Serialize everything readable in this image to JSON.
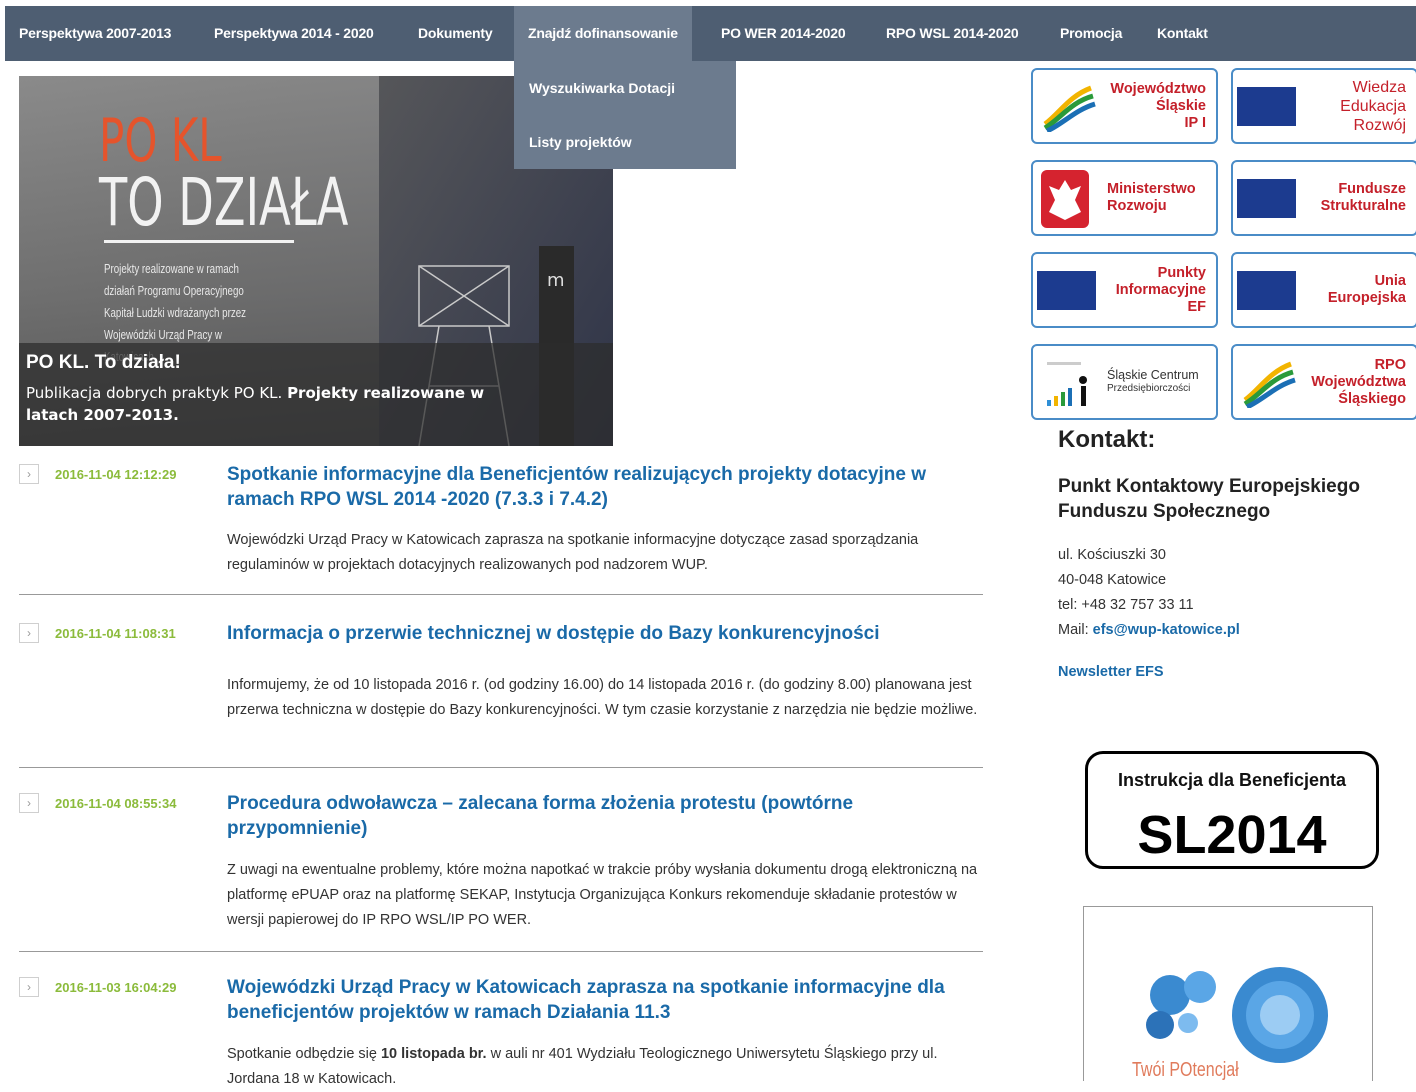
{
  "nav": {
    "items": [
      {
        "label": "Perspektywa 2007-2013"
      },
      {
        "label": "Perspektywa 2014 - 2020"
      },
      {
        "label": "Dokumenty"
      },
      {
        "label": "Znajdź dofinansowanie",
        "active": true
      },
      {
        "label": "PO WER 2014-2020"
      },
      {
        "label": "RPO WSL 2014-2020"
      },
      {
        "label": "Promocja"
      },
      {
        "label": "Kontakt"
      }
    ],
    "dropdown": [
      "Wyszukiwarka Dotacji",
      "Listy projektów"
    ],
    "background": "#4e5e72",
    "active_background": "#6c7b8e"
  },
  "hero": {
    "image_title_line1": "PO KL",
    "image_title_line2": "TO DZIAŁA",
    "image_small_text": "Projekty realizowane w ramach działań Programu Operacyjnego Kapitał Ludzki wdrażanych przez Wojewódzki Urząd Pracy w Katowicach",
    "caption_title": "PO KL. To działa!",
    "caption_text_plain": "Publikacja dobrych praktyk PO KL. ",
    "caption_text_bold": "Projekty realizowane w latach 2007-2013."
  },
  "news": [
    {
      "date": "2016-11-04 12:12:29",
      "title": "Spotkanie informacyjne dla Beneficjentów realizujących projekty dotacyjne w ramach RPO WSL 2014 -2020 (7.3.3 i 7.4.2)",
      "body": "Wojewódzki Urząd Pracy w Katowicach zaprasza na spotkanie informacyjne dotyczące zasad sporządzania regulaminów w projektach dotacyjnych realizowanych pod nadzorem WUP."
    },
    {
      "date": "2016-11-04 11:08:31",
      "title": "Informacja o przerwie technicznej w dostępie do Bazy konkurencyjności",
      "body": "Informujemy, że od 10 listopada 2016 r. (od godziny 16.00) do 14 listopada 2016 r. (do godziny 8.00) planowana jest przerwa techniczna w dostępie do Bazy konkurencyjności. W tym czasie korzystanie z narzędzia nie będzie możliwe."
    },
    {
      "date": "2016-11-04 08:55:34",
      "title": "Procedura odwoławcza – zalecana forma złożenia protestu (powtórne przypomnienie)",
      "body": "Z uwagi na ewentualne problemy, które można napotkać w trakcie próby wysłania dokumentu drogą elektroniczną na platformę ePUAP oraz na platformę SEKAP, Instytucja Organizująca Konkurs rekomenduje składanie protestów w wersji papierowej do IP RPO WSL/IP PO WER."
    },
    {
      "date": "2016-11-03 16:04:29",
      "title": "Wojewódzki Urząd Pracy w Katowicach zaprasza na spotkanie informacyjne dla beneficjentów projektów w ramach Działania 11.3",
      "body_start": "Spotkanie odbędzie się ",
      "body_bold": "10 listopada br.",
      "body_end": " w auli nr 401 Wydziału Teologicznego Uniwersytetu Śląskiego przy ul. Jordana 18 w Katowicach."
    }
  ],
  "logos": [
    {
      "lines": [
        "Województwo",
        "Śląskie",
        "IP I"
      ],
      "icon": "silesia-wave-logo",
      "color": "#c4202a"
    },
    {
      "lines": [
        "Wiedza",
        "Edukacja",
        "Rozwój"
      ],
      "icon": "eu-flag",
      "color": "#c4202a"
    },
    {
      "lines": [
        "Ministerstwo",
        "Rozwoju"
      ],
      "icon": "polish-eagle",
      "color": "#c4202a"
    },
    {
      "lines": [
        "Fundusze",
        "Strukturalne"
      ],
      "icon": "eu-flag",
      "color": "#c4202a"
    },
    {
      "lines": [
        "Punkty",
        "Informacyjne",
        "EF"
      ],
      "icon": "eu-flag",
      "color": "#c4202a"
    },
    {
      "lines": [
        "Unia",
        "Europejska"
      ],
      "icon": "eu-flag",
      "color": "#c4202a"
    },
    {
      "lines": [
        "Śląskie Centrum",
        "Przedsiębiorczości"
      ],
      "icon": "scp-bars-logo",
      "color": "#333333"
    },
    {
      "lines": [
        "RPO",
        "Województwa",
        "Śląskiego"
      ],
      "icon": "silesia-wave-logo",
      "color": "#c4202a"
    }
  ],
  "contact": {
    "heading": "Kontakt:",
    "org": "Punkt Kontaktowy Europejskiego Funduszu Społecznego",
    "street": "ul. Kościuszki 30",
    "city": "40-048 Katowice",
    "phone": "tel: +48 32 757 33 11",
    "mail_label": "Mail: ",
    "mail": "efs@wup-katowice.pl",
    "newsletter": "Newsletter EFS"
  },
  "banners": {
    "sl_small": "Instrukcja dla Beneficjenta",
    "sl_big": "SL2014",
    "tp_text": "Twói POtencjał"
  }
}
